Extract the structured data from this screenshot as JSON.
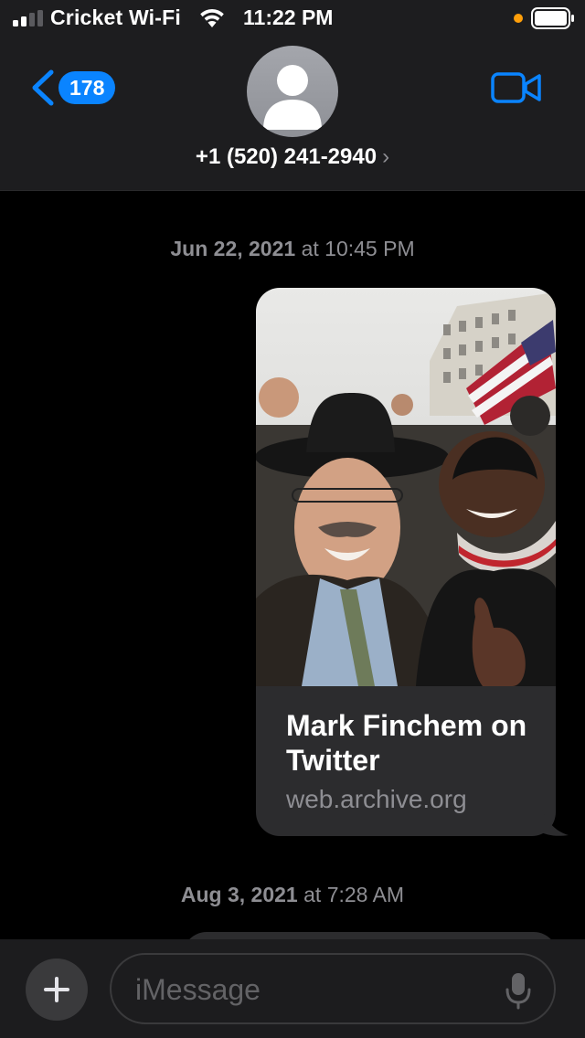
{
  "status_bar": {
    "carrier": "Cricket Wi-Fi",
    "time": "11:22 PM",
    "signal_bars_active": 2,
    "signal_bars_total": 4
  },
  "header": {
    "back_badge": "178",
    "contact": "+1 (520) 241-2940",
    "contact_chevron": "›",
    "icons": {
      "back": "chevron-left-icon",
      "avatar": "person-icon",
      "video": "video-camera-icon"
    }
  },
  "conversation": {
    "timestamps": [
      {
        "date": "Jun 22, 2021",
        "sep": " at ",
        "time": "10:45 PM"
      },
      {
        "date": "Aug 3, 2021",
        "sep": " at ",
        "time": "7:28 AM"
      }
    ],
    "link_preview": {
      "title": "Mark Finchem on Twitter",
      "domain": "web.archive.org"
    }
  },
  "input": {
    "placeholder": "iMessage",
    "icons": {
      "plus": "plus-icon",
      "mic": "microphone-icon"
    }
  },
  "colors": {
    "accent": "#0a84ff",
    "header_bg": "#1d1d1f",
    "bubble_bg": "#2c2c2e",
    "secondary_text": "#8e8e93",
    "recording_dot": "#ff9f0a"
  }
}
